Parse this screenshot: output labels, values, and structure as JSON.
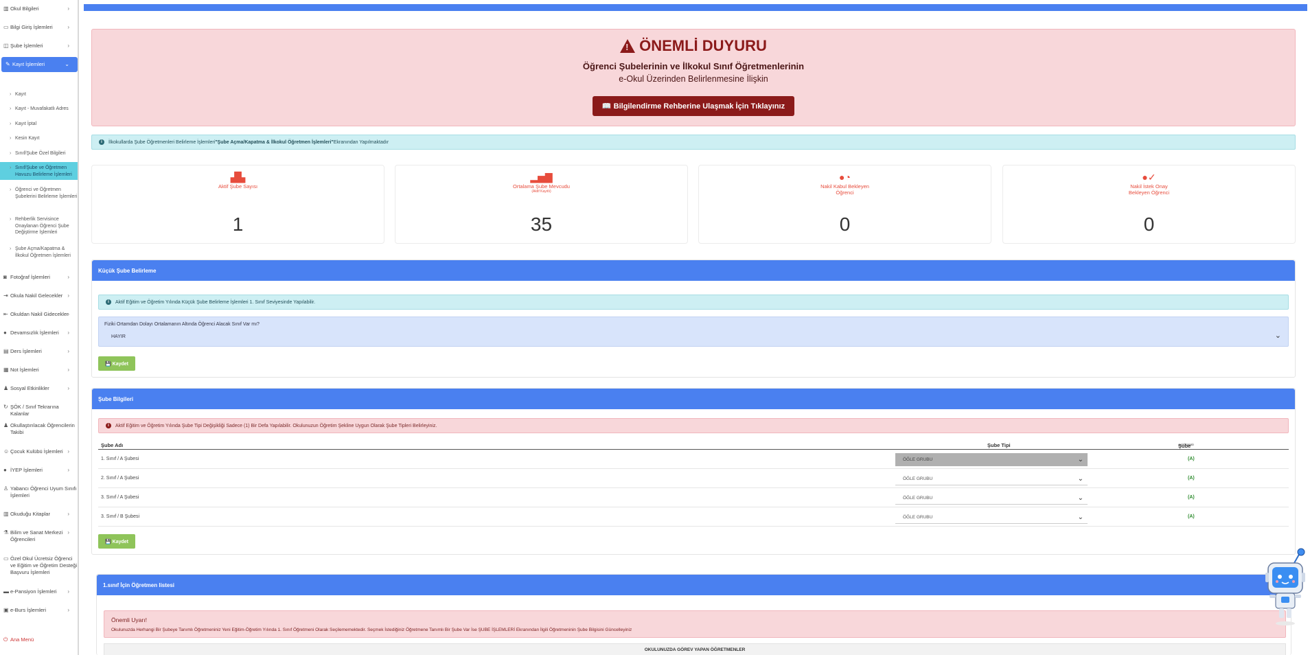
{
  "sidebar": {
    "items_top": [
      {
        "label": "Okul Bilgileri",
        "icon": "building-icon"
      },
      {
        "label": "Bilgi Giriş İşlemleri",
        "icon": "keyboard-icon"
      },
      {
        "label": "Şube İşlemleri",
        "icon": "chalkboard-icon"
      }
    ],
    "active": {
      "label": "Kayıt İşlemleri",
      "icon": "edit-icon"
    },
    "sub_items": [
      "Kayıt",
      "Kayıt - Muvafakatlı Adres",
      "Kayıt İptal",
      "Kesin Kayıt",
      "Sınıf/Şube Özel Bilgileri",
      "Sınıf/Şube ve Öğretmen Havuzu Belirleme İşlemleri",
      "Öğrenci ve Öğretmen Şubelerini Belirleme İşlemleri",
      "Rehberlik Servisince Onaylanan Öğrenci Şube Değiştirme İşlemleri",
      "Şube Açma/Kapatma & İlkokul Öğretmen İşlemleri"
    ],
    "items_bottom": [
      {
        "label": "Fotoğraf İşlemleri",
        "icon": "camera-icon"
      },
      {
        "label": "Okula Nakil Gelecekler",
        "icon": "arrow-in-icon"
      },
      {
        "label": "Okuldan Nakil Gidecekler",
        "icon": "arrow-out-icon"
      },
      {
        "label": "Devamsızlık İşlemleri",
        "icon": "user-icon"
      },
      {
        "label": "Ders İşlemleri",
        "icon": "book-icon"
      },
      {
        "label": "Not İşlemleri",
        "icon": "list-icon"
      },
      {
        "label": "Sosyal Etkinlikler",
        "icon": "users-icon"
      },
      {
        "label": "ŞÖK / Sınıf Tekrarına Kalanlar",
        "icon": "rotate-icon"
      },
      {
        "label": "Okullaştırılacak Öğrencilerin Takibi",
        "icon": "group-icon"
      },
      {
        "label": "Çocuk Kulübü İşlemleri",
        "icon": "child-icon"
      },
      {
        "label": "İYEP İşlemleri",
        "icon": "user-gear-icon"
      },
      {
        "label": "Yabancı Öğrenci Uyum Sınıfı İşlemleri",
        "icon": "person-icon"
      },
      {
        "label": "Okuduğu Kitaplar",
        "icon": "books-icon"
      },
      {
        "label": "Bilim ve Sanat Merkezi Öğrencileri",
        "icon": "flask-icon"
      },
      {
        "label": "Özel Okul Ücretsiz Öğrenci ve Eğitim ve Öğretim Desteği Başvuru İşlemleri",
        "icon": "card-icon"
      },
      {
        "label": "e-Pansiyon İşlemleri",
        "icon": "bed-icon"
      },
      {
        "label": "e-Burs İşlemleri",
        "icon": "wallet-icon"
      }
    ],
    "home": {
      "label": "Ana Menü",
      "icon": "power-icon"
    }
  },
  "announcement": {
    "title": "ÖNEMLİ DUYURU",
    "line1": "Öğrenci Şubelerinin ve İlkokul Sınıf Öğretmenlerinin",
    "line2": "e-Okul Üzerinden Belirlenmesine İlişkin",
    "button": "📖 Bilgilendirme Rehberine Ulaşmak İçin Tıklayınız"
  },
  "info_strip": {
    "pre": "İlkokullarda Şube Öğretmenleri Belirleme İşlemleri ",
    "bold": "\"Şube Açma/Kapatma & İlkokul Öğretmen İşlemleri\"",
    "post": " Ekranından Yapılmaktadır"
  },
  "stats": [
    {
      "label": "Aktif Şube Sayısı",
      "sub": "",
      "value": "1",
      "icon": "building-icon"
    },
    {
      "label": "Ortalama Şube Mevcudu",
      "sub": "(Aktif Kayıtlı)",
      "value": "35",
      "icon": "bar-chart-icon"
    },
    {
      "label": "Nakil Kabul Bekleyen Öğrenci",
      "sub": "",
      "value": "0",
      "icon": "user-clock-icon"
    },
    {
      "label": "Nakil İstek Onay Bekleyen Öğrenci",
      "sub": "",
      "value": "0",
      "icon": "user-check-icon"
    }
  ],
  "small_branch": {
    "header": "Küçük Şube Belirleme",
    "info": "Aktif Eğitim ve Öğretim Yılında Küçük Şube Belirleme İşlemleri 1. Sınıf Seviyesinde Yapılabilir.",
    "question": "Fiziki Ortamdan Dolayı Ortalamanın Altında Öğrenci Alacak Sınıf Var mı?",
    "value": "HAYIR",
    "save": "💾 Kaydet"
  },
  "branch_info": {
    "header": "Şube Bilgileri",
    "alert": "Aktif Eğitim ve Öğretim Yılında Şube Tipi Değişikliği Sadece (1) Bir Defa Yapılabilir. Okulunuzun Öğretim Şekline Uygun Olarak Şube Tipleri Belirleyiniz.",
    "col_name": "Şube Adı",
    "col_type": "Şube Tipi",
    "col_status": "Şube",
    "col_status_small": "Açık/Kapalı",
    "rows": [
      {
        "name": "1. Sınıf / A Şubesi",
        "type": "ÖĞLE GRUBU",
        "status": "(A)"
      },
      {
        "name": "2. Sınıf / A Şubesi",
        "type": "ÖĞLE GRUBU",
        "status": "(A)"
      },
      {
        "name": "3. Sınıf / A Şubesi",
        "type": "ÖĞLE GRUBU",
        "status": "(A)"
      },
      {
        "name": "3. Sınıf / B Şubesi",
        "type": "ÖĞLE GRUBU",
        "status": "(A)"
      }
    ],
    "save": "💾 Kaydet"
  },
  "teacher_list": {
    "header": "1.sınıf İçin Öğretmen listesi",
    "warn_title": "Önemli Uyarı!",
    "warn_text": "Okulunuzda Herhangi Bir Şubeye Tanımlı Öğretmeniniz Yeni Eğitim-Öğretim Yılında 1. Sınıf Öğretmeni Olarak Seçilememektedir. Seçmek İstediğiniz Öğretmene Tanımlı Bir Şube Var İse ŞUBE İŞLEMLERİ Ekranından İlgili Öğretmeninin Şube Bilgisini Güncelleyiniz",
    "table_head": "OKULUNUZDA GÖREV YAPAN ÖĞRETMENLER"
  },
  "colors": {
    "primary": "#4a80f0",
    "danger_bg": "#f8d7da",
    "danger_text": "#8b1a1a",
    "info_bg": "#cdeff3",
    "success": "#8fc45a",
    "stat_red": "#e74c3c"
  }
}
